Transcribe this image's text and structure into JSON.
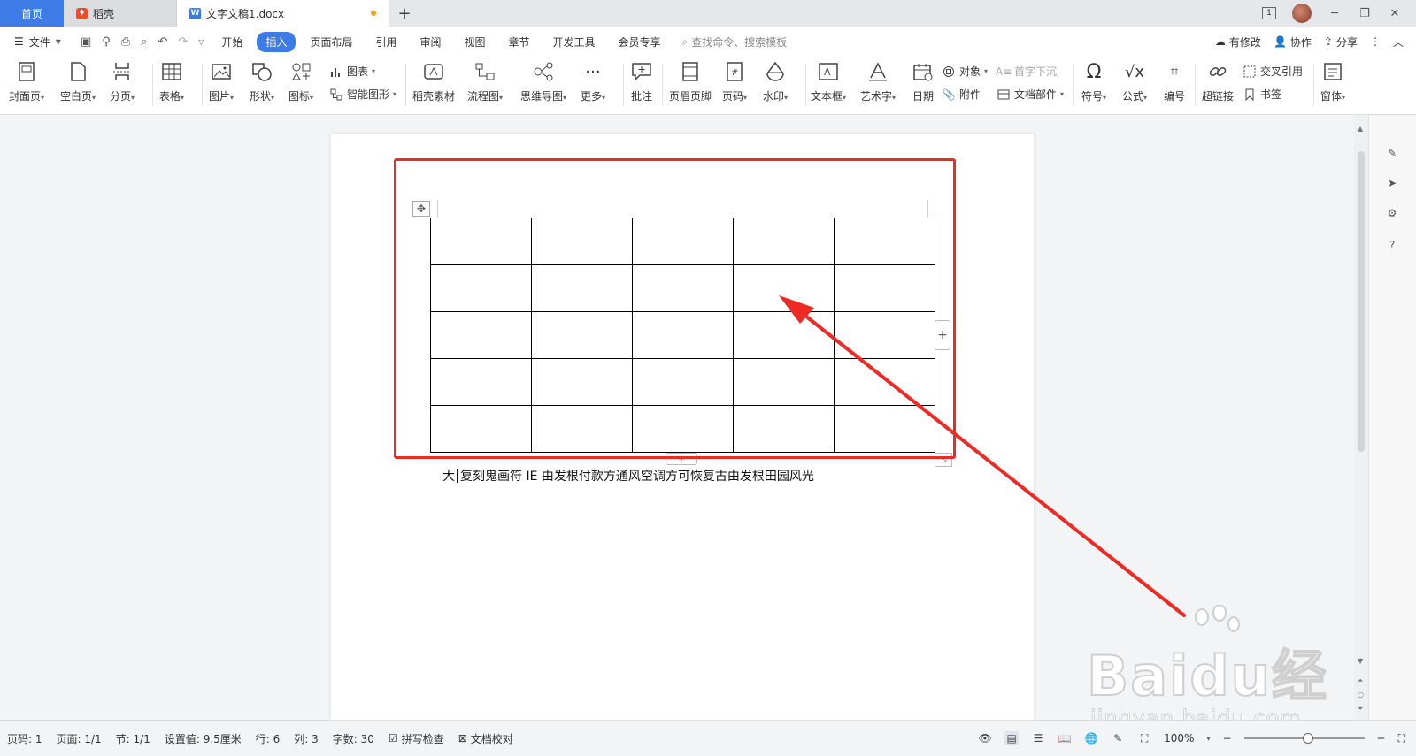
{
  "tabs": {
    "home": "首页",
    "daoke": "稻壳",
    "doc": "文字文稿1.docx"
  },
  "menu": {
    "file": "文件",
    "tabs": [
      "开始",
      "插入",
      "页面布局",
      "引用",
      "审阅",
      "视图",
      "章节",
      "开发工具",
      "会员专享"
    ],
    "search": "查找命令、搜索模板",
    "modified": "有修改",
    "collab": "协作",
    "share": "分享"
  },
  "ribbon": {
    "cover": "封面页",
    "blank": "空白页",
    "pagebreak": "分页",
    "table": "表格",
    "picture": "图片",
    "shape": "形状",
    "icon": "图标",
    "chart": "图表",
    "smartart": "智能图形",
    "daoke_material": "稻壳素材",
    "flowchart": "流程图",
    "mindmap": "思维导图",
    "more": "更多",
    "comment": "批注",
    "header_footer": "页眉页脚",
    "page_number": "页码",
    "watermark": "水印",
    "textbox": "文本框",
    "wordart": "艺术字",
    "date": "日期",
    "object": "对象",
    "attachment": "附件",
    "dropcap": "首字下沉",
    "doc_parts": "文档部件",
    "symbol": "符号",
    "formula": "公式",
    "numbering": "编号",
    "hyperlink": "超链接",
    "cross_ref": "交叉引用",
    "bookmark": "书签",
    "window": "窗体"
  },
  "document": {
    "table_rows": 5,
    "table_cols": 5,
    "body_before_cursor": "大",
    "body_after_cursor": "复刻鬼画符 IE 由发根付款方通风空调方可恢复古由发根田园风光"
  },
  "status": {
    "page_code": "页码: 1",
    "pages": "页面: 1/1",
    "section": "节: 1/1",
    "setting": "设置值: 9.5厘米",
    "row": "行: 6",
    "col": "列: 3",
    "words": "字数: 30",
    "spellcheck": "拼写检查",
    "proofread": "文档校对",
    "zoom": "100%"
  },
  "watermark": {
    "brand": "Baidu经验",
    "url": "jingyan.baidu.com"
  },
  "colors": {
    "accent": "#3d7ce6",
    "highlight": "#ee2a24"
  }
}
